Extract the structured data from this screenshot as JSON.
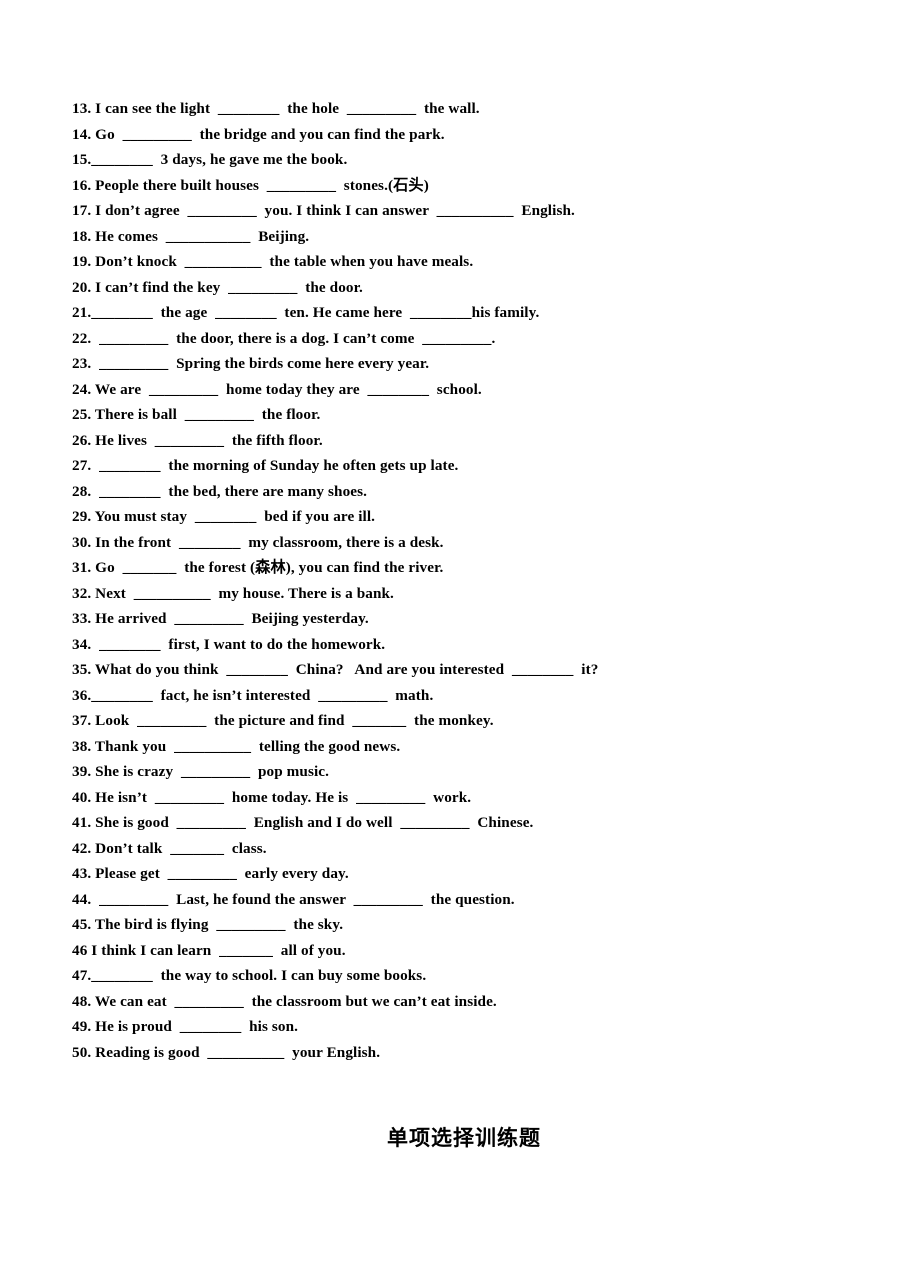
{
  "document": {
    "type": "worksheet",
    "language_mix": "English with Chinese glosses",
    "background_color": "#ffffff",
    "text_color": "#000000"
  },
  "exercises": [
    {
      "number": "13.",
      "text": "13. I can see the light  ________  the hole  _________  the wall."
    },
    {
      "number": "14.",
      "text": "14. Go  _________  the bridge and you can find the park."
    },
    {
      "number": "15.",
      "text": "15.________  3 days, he gave me the book."
    },
    {
      "number": "16.",
      "text": "16. People there built houses  _________  stones.(石头)"
    },
    {
      "number": "17.",
      "text": "17. I don’t agree  _________  you. I think I can answer  __________  English."
    },
    {
      "number": "18.",
      "text": "18. He comes  ___________  Beijing."
    },
    {
      "number": "19.",
      "text": "19. Don’t knock  __________  the table when you have meals."
    },
    {
      "number": "20.",
      "text": "20. I can’t find the key  _________  the door."
    },
    {
      "number": "21.",
      "text": "21.________  the age  ________  ten. He came here  ________his family."
    },
    {
      "number": "22.",
      "text": "22.  _________  the door, there is a dog. I can’t come  _________."
    },
    {
      "number": "23.",
      "text": "23.  _________  Spring the birds come here every year."
    },
    {
      "number": "24.",
      "text": "24. We are  _________  home today they are  ________  school."
    },
    {
      "number": "25.",
      "text": "25. There is ball  _________  the floor."
    },
    {
      "number": "26.",
      "text": "26. He lives  _________  the fifth floor."
    },
    {
      "number": "27.",
      "text": "27.  ________  the morning of Sunday he often gets up late."
    },
    {
      "number": "28.",
      "text": "28.  ________  the bed, there are many shoes."
    },
    {
      "number": "29.",
      "text": "29. You must stay  ________  bed if you are ill."
    },
    {
      "number": "30.",
      "text": "30. In the front  ________  my classroom, there is a desk."
    },
    {
      "number": "31.",
      "text": "31. Go  _______  the forest (森林), you can find the river."
    },
    {
      "number": "32.",
      "text": "32. Next  __________  my house. There is a bank."
    },
    {
      "number": "33.",
      "text": "33. He arrived  _________  Beijing yesterday."
    },
    {
      "number": "34.",
      "text": "34.  ________  first, I want to do the homework."
    },
    {
      "number": "35.",
      "text": "35. What do you think  ________  China?   And are you interested  ________  it?"
    },
    {
      "number": "36.",
      "text": "36.________  fact, he isn’t interested  _________  math."
    },
    {
      "number": "37.",
      "text": "37. Look  _________  the picture and find  _______  the monkey."
    },
    {
      "number": "38.",
      "text": "38. Thank you  __________  telling the good news."
    },
    {
      "number": "39.",
      "text": "39. She is crazy  _________  pop music."
    },
    {
      "number": "40.",
      "text": "40. He isn’t  _________  home today. He is  _________  work."
    },
    {
      "number": "41.",
      "text": "41. She is good  _________  English and I do well  _________  Chinese."
    },
    {
      "number": "42.",
      "text": "42. Don’t talk  _______  class."
    },
    {
      "number": "43.",
      "text": "43. Please get  _________  early every day."
    },
    {
      "number": "44.",
      "text": "44.  _________  Last, he found the answer  _________  the question."
    },
    {
      "number": "45.",
      "text": "45. The bird is flying  _________  the sky."
    },
    {
      "number": "46",
      "text": "46 I think I can learn  _______  all of you."
    },
    {
      "number": "47.",
      "text": "47.________  the way to school. I can buy some books."
    },
    {
      "number": "48.",
      "text": "48. We can eat  _________  the classroom but we can’t eat inside."
    },
    {
      "number": "49.",
      "text": "49. He is proud  ________  his son."
    },
    {
      "number": "50.",
      "text": "50. Reading is good  __________  your English."
    }
  ],
  "section_heading": {
    "label": "单项选择训练题"
  }
}
